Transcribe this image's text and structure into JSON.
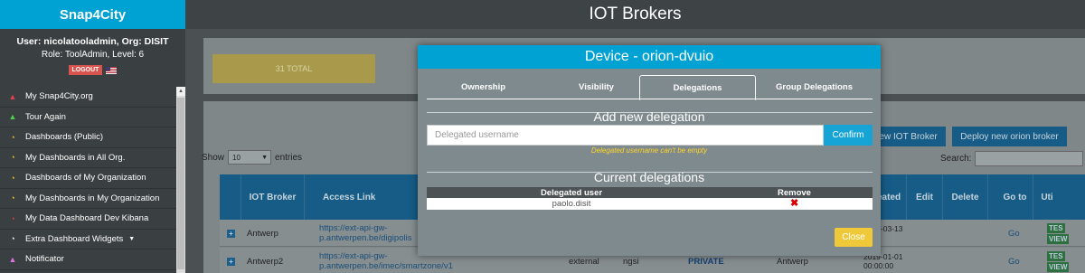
{
  "sidebar": {
    "brand": "Snap4City",
    "user_line": "User: nicolatooladmin, Org: DISIT",
    "role_line": "Role: ToolAdmin, Level: 6",
    "logout_label": "LOGOUT",
    "items": [
      {
        "label": "My Snap4City.org",
        "icon": "user-icon",
        "icon_color": "#e0404a"
      },
      {
        "label": "Tour Again",
        "icon": "bell-icon",
        "icon_color": "#4cd04c"
      },
      {
        "label": "Dashboards (Public)",
        "icon": "dashboard-icon",
        "icon_color": "#f0c030"
      },
      {
        "label": "My Dashboards in All Org.",
        "icon": "dashboard-icon",
        "icon_color": "#f0c030"
      },
      {
        "label": "Dashboards of My Organization",
        "icon": "dashboard-icon",
        "icon_color": "#f0c030"
      },
      {
        "label": "My Dashboards in My Organization",
        "icon": "dashboard-icon",
        "icon_color": "#f0c030"
      },
      {
        "label": "My Data Dashboard Dev Kibana",
        "icon": "dashboard-icon",
        "icon_color": "#e0404a"
      },
      {
        "label": "Extra Dashboard Widgets",
        "icon": "dashboard-icon",
        "icon_color": "#ffffff"
      },
      {
        "label": "Notificator",
        "icon": "bell-icon",
        "icon_color": "#e070e0"
      }
    ]
  },
  "header": {
    "title": "IOT Brokers"
  },
  "main": {
    "total_label": "31 TOTAL",
    "new_broker_label": "New IOT Broker",
    "deploy_label": "Deploy new orion broker",
    "show_label": "Show",
    "show_value": "10",
    "entries_label": "entries",
    "search_label": "Search:",
    "columns": [
      "IOT Broker",
      "Access Link",
      "Created",
      "Edit",
      "Delete",
      "Go to",
      "Uti"
    ],
    "rows": [
      {
        "name": "Antwerp",
        "link": "https://ext-api-gw-p.antwerpen.be/digipolis",
        "created": "2019-03-13 ...17",
        "go": "Go",
        "tag1": "TES",
        "tag2": "VIEW"
      },
      {
        "name": "Antwerp2",
        "link": "https://ext-api-gw-p.antwerpen.be/imec/smartzone/v1",
        "kind": "external",
        "protocol": "ngsi",
        "visibility": "PRIVATE",
        "org": "Antwerp",
        "created": "2019-01-01 00:00:00",
        "go": "Go",
        "tag1": "TES",
        "tag2": "VIEW"
      }
    ]
  },
  "modal": {
    "title": "Device - orion-dvuio",
    "tabs": [
      "Ownership",
      "Visibility",
      "Delegations",
      "Group Delegations"
    ],
    "active_tab": "Delegations",
    "add_title": "Add new delegation",
    "input_placeholder": "Delegated username",
    "confirm_label": "Confirm",
    "warning": "Delegated username can't be empty",
    "current_title": "Current delegations",
    "table_headers": {
      "user": "Delegated user",
      "remove": "Remove"
    },
    "delegations": [
      {
        "user": "paolo.disit"
      }
    ],
    "close_label": "Close"
  }
}
